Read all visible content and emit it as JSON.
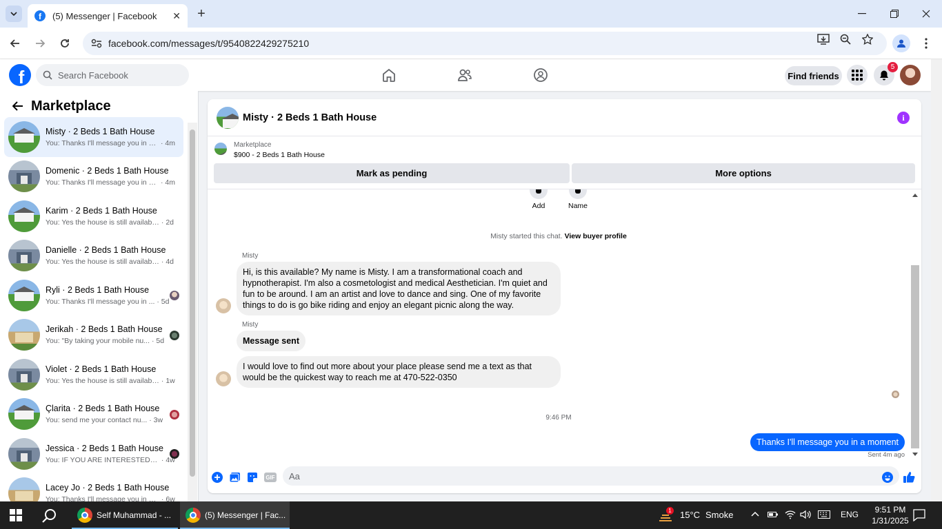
{
  "browser": {
    "tab_title": "(5) Messenger | Facebook",
    "url": "facebook.com/messages/t/9540822429275210"
  },
  "fb_header": {
    "search_placeholder": "Search Facebook",
    "find_friends": "Find friends",
    "notification_count": "5",
    "brand_color": "#0866ff"
  },
  "sidebar": {
    "title": "Marketplace",
    "conversations": [
      {
        "name": "Misty · 2 Beds 1 Bath House",
        "preview": "You: Thanks I'll message you in a ...",
        "time": "· 4m",
        "thumb": "white"
      },
      {
        "name": "Domenic · 2 Beds 1 Bath House",
        "preview": "You: Thanks I'll message you in a ...",
        "time": "· 4m",
        "thumb": "gray"
      },
      {
        "name": "Karim · 2 Beds 1 Bath House",
        "preview": "You: Yes the house is still available...",
        "time": "· 2d",
        "thumb": "white"
      },
      {
        "name": "Danielle · 2 Beds 1 Bath House",
        "preview": "You: Yes the house is still available...",
        "time": "· 4d",
        "thumb": "gray"
      },
      {
        "name": "Ryli · 2 Beds 1 Bath House",
        "preview": "You: Thanks I'll message you in ...",
        "time": "· 5d",
        "thumb": "white"
      },
      {
        "name": "Jerikah · 2 Beds 1 Bath House",
        "preview": "You: \"By taking your mobile nu...",
        "time": "· 5d",
        "thumb": "tan"
      },
      {
        "name": "Violet · 2 Beds 1 Bath House",
        "preview": "You: Yes the house is still available...",
        "time": "· 1w",
        "thumb": "gray"
      },
      {
        "name": "Çlarita · 2 Beds 1 Bath House",
        "preview": "You: send me your contact nu...",
        "time": "· 3w",
        "thumb": "white"
      },
      {
        "name": "Jessica · 2 Beds 1 Bath House",
        "preview": "You: IF YOU ARE INTERESTED S...",
        "time": "· 4w",
        "thumb": "gray"
      },
      {
        "name": "Lacey Jo · 2 Beds 1 Bath House",
        "preview": "You: Thanks I'll message you in a ...",
        "time": "· 6w",
        "thumb": "tan"
      }
    ]
  },
  "chat": {
    "title": "Misty · 2 Beds 1 Bath House",
    "listing_source": "Marketplace",
    "listing_price": "$900 - 2 Beds 1 Bath House",
    "mark_pending": "Mark as pending",
    "more_options": "More options",
    "quick_actions": [
      "Add",
      "Name"
    ],
    "started_prefix": "Misty started this chat.",
    "view_profile": "View buyer profile",
    "sender_name": "Misty",
    "msg1": "Hi, is this available? My name is Misty. I am a transformational coach and hypnotherapist. I'm also a cosmetologist and medical Aesthetician. I'm quiet and fun to be around. I am an artist and love to dance and sing. One of my favorite things to do is go bike riding and enjoy an elegant picnic along the way.",
    "msg2": "Message sent",
    "msg3": "I would love to find out more about your place please send me a text as that would be the quickest way to reach me at 470-522-0350",
    "timestamp": "9:46 PM",
    "outgoing": "Thanks I'll message you in a moment",
    "sent_status": "Sent 4m ago",
    "composer_placeholder": "Aa",
    "gif_label": "GIF"
  },
  "taskbar": {
    "app1": "Self Muhammad - ...",
    "app2": "(5) Messenger | Fac...",
    "weather_temp": "15°C",
    "weather_desc": "Smoke",
    "weather_badge": "1",
    "lang": "ENG",
    "time": "9:51 PM",
    "date": "1/31/2025"
  }
}
